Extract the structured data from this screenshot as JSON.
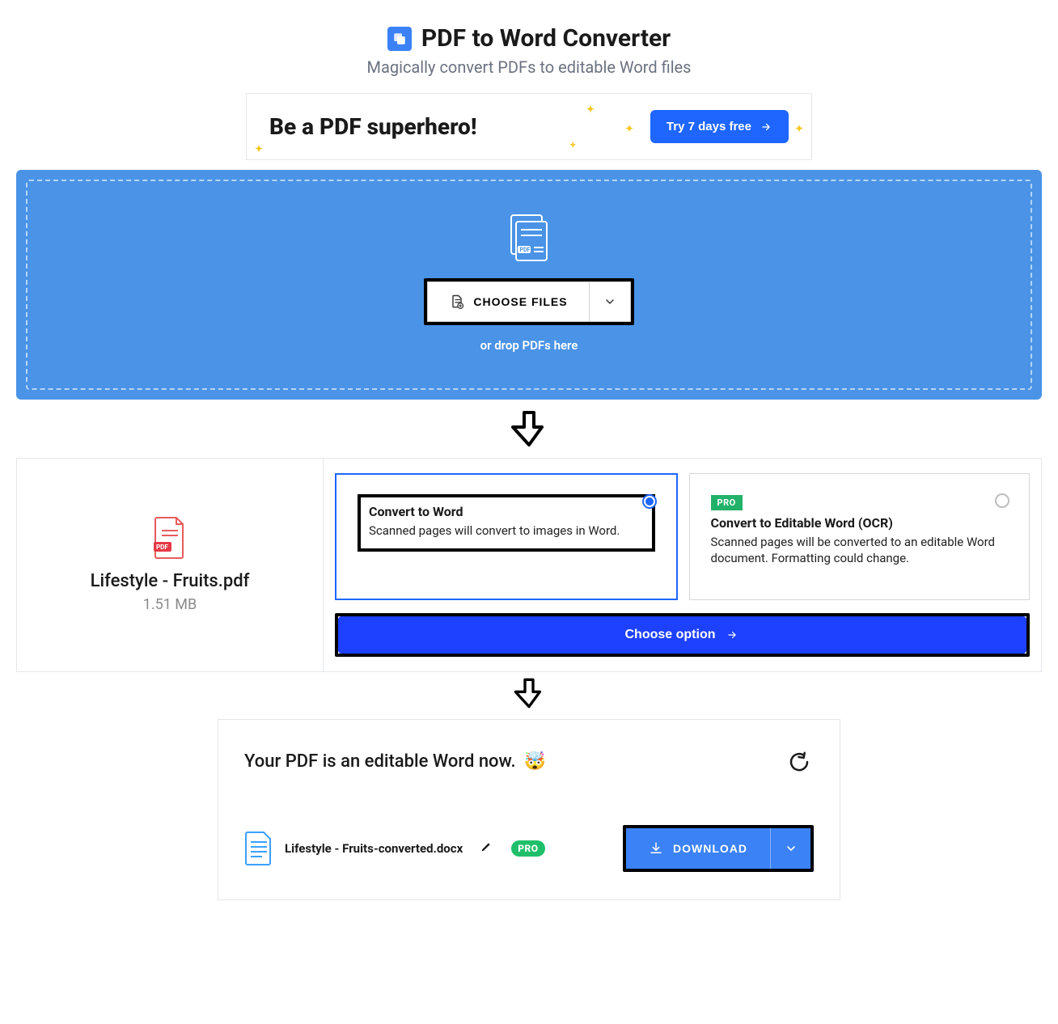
{
  "header": {
    "title": "PDF to Word Converter",
    "subtitle": "Magically convert PDFs to editable Word files"
  },
  "promo": {
    "title": "Be a PDF superhero!",
    "cta": "Try 7 days free"
  },
  "dropzone": {
    "choose_label": "CHOOSE FILES",
    "hint": "or drop PDFs here"
  },
  "file": {
    "name": "Lifestyle - Fruits.pdf",
    "size": "1.51 MB"
  },
  "options": {
    "a": {
      "title": "Convert to Word",
      "desc": "Scanned pages will convert to images in Word."
    },
    "b": {
      "badge": "PRO",
      "title": "Convert to Editable Word (OCR)",
      "desc": "Scanned pages will be converted to an editable Word document. Formatting could change."
    },
    "choose_label": "Choose option"
  },
  "result": {
    "message": "Your PDF is an editable Word now.",
    "emoji": "🤯",
    "file_name": "Lifestyle - Fruits-converted.docx",
    "pro_label": "PRO",
    "download_label": "DOWNLOAD"
  }
}
